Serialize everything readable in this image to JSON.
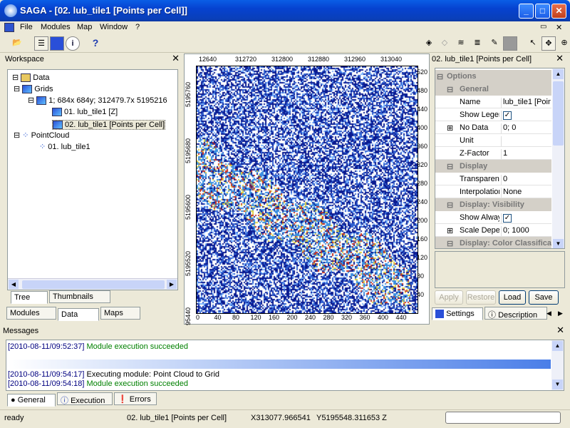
{
  "window": {
    "title": "SAGA - [02. lub_tile1 [Points per Cell]]"
  },
  "menu": [
    "File",
    "Modules",
    "Map",
    "Window",
    "?"
  ],
  "workspace": {
    "title": "Workspace",
    "tree": {
      "root": "Data",
      "grids": "Grids",
      "system": "1; 684x 684y; 312479.7x 5195216",
      "grid1": "01. lub_tile1 [Z]",
      "grid2": "02. lub_tile1 [Points per Cell]",
      "pointcloud": "PointCloud",
      "pc1": "01. lub_tile1"
    },
    "view_tabs": [
      "Tree",
      "Thumbnails"
    ],
    "bottom_tabs": [
      "Modules",
      "Data",
      "Maps"
    ]
  },
  "map": {
    "top_ticks": [
      "12640",
      "312720",
      "312800",
      "312880",
      "312960",
      "313040"
    ],
    "left_ticks": [
      "5195760",
      "5195680",
      "5195600",
      "5195520",
      "5195440",
      "5195360"
    ],
    "bottom_ticks": [
      "0",
      "40",
      "80",
      "120",
      "160",
      "200",
      "240",
      "280",
      "320",
      "360",
      "400",
      "440"
    ],
    "right_ticks": [
      "520",
      "480",
      "440",
      "400",
      "360",
      "320",
      "280",
      "240",
      "200",
      "160",
      "120",
      "80",
      "40"
    ]
  },
  "properties": {
    "title": "02. lub_tile1 [Points per Cell]",
    "groups": {
      "options": "Options",
      "general": "General",
      "display": "Display",
      "visibility": "Display: Visibility",
      "color": "Display: Color Classifica"
    },
    "rows": {
      "name_k": "Name",
      "name_v": "lub_tile1 [Poin",
      "legend_k": "Show Legend",
      "nodata_k": "No Data",
      "nodata_v": "0; 0",
      "unit_k": "Unit",
      "unit_v": "",
      "zfactor_k": "Z-Factor",
      "zfactor_v": "1",
      "transp_k": "Transparency",
      "transp_v": "0",
      "interp_k": "Interpolation",
      "interp_v": "None",
      "showalways_k": "Show Always",
      "scale_k": "Scale Depende",
      "scale_v": "0; 1000"
    },
    "buttons": {
      "apply": "Apply",
      "restore": "Restore",
      "load": "Load",
      "save": "Save"
    },
    "tabs": [
      "Settings",
      "Description"
    ]
  },
  "messages": {
    "title": "Messages",
    "lines": [
      {
        "ts": "[2010-08-11/09:52:37]",
        "text": "Module execution succeeded"
      },
      {
        "ts": "[2010-08-11/09:54:17]",
        "text": "Executing module: Point Cloud to Grid"
      },
      {
        "ts": "[2010-08-11/09:54:18]",
        "text": "Module execution succeeded"
      }
    ],
    "tabs": [
      "General",
      "Execution",
      "Errors"
    ]
  },
  "status": {
    "ready": "ready",
    "layer": "02. lub_tile1 [Points per Cell]",
    "x": "X313077.966541",
    "y": "Y5195548.311653 Z"
  },
  "colors": {
    "accent": "#0a5ee6",
    "success": "#008000",
    "timestamp": "#000080"
  }
}
